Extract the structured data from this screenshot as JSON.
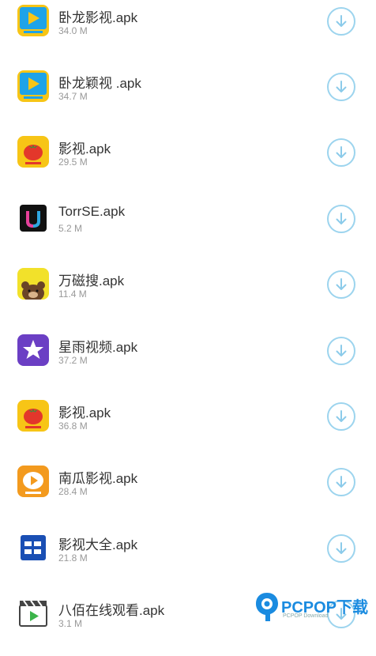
{
  "items": [
    {
      "name": "卧龙影视.apk",
      "size": "34.0 M",
      "icon": "wolong-play-icon",
      "color": "#1ea3e8"
    },
    {
      "name": "卧龙颖视 .apk",
      "size": "34.7 M",
      "icon": "wolong-play-icon",
      "color": "#1ea3e8"
    },
    {
      "name": "影视.apk",
      "size": "29.5 M",
      "icon": "tomato-icon",
      "color": "#f7c516"
    },
    {
      "name": "TorrSE.apk",
      "size": "5.2 M",
      "icon": "torrse-u-icon",
      "color": "#111111"
    },
    {
      "name": "万磁搜.apk",
      "size": "11.4 M",
      "icon": "bear-icon",
      "color": "#f2e12a"
    },
    {
      "name": "星雨视频.apk",
      "size": "37.2 M",
      "icon": "star-icon",
      "color": "#6b3fc4"
    },
    {
      "name": "影视.apk",
      "size": "36.8 M",
      "icon": "tomato-icon",
      "color": "#f7c516"
    },
    {
      "name": "南瓜影视.apk",
      "size": "28.4 M",
      "icon": "pumpkin-play-icon",
      "color": "#f39a1e"
    },
    {
      "name": "影视大全.apk",
      "size": "21.8 M",
      "icon": "yingshi-daquan-icon",
      "color": "#1a4fb4"
    },
    {
      "name": "八佰在线观看.apk",
      "size": "3.1 M",
      "icon": "clapperboard-icon",
      "color": "#ffffff"
    }
  ],
  "watermark": {
    "brand": "PCPOP下载",
    "sub": "PCPOP Download"
  },
  "colors": {
    "download_ring": "#9cd4ee",
    "name_text": "#333333",
    "size_text": "#999999"
  }
}
